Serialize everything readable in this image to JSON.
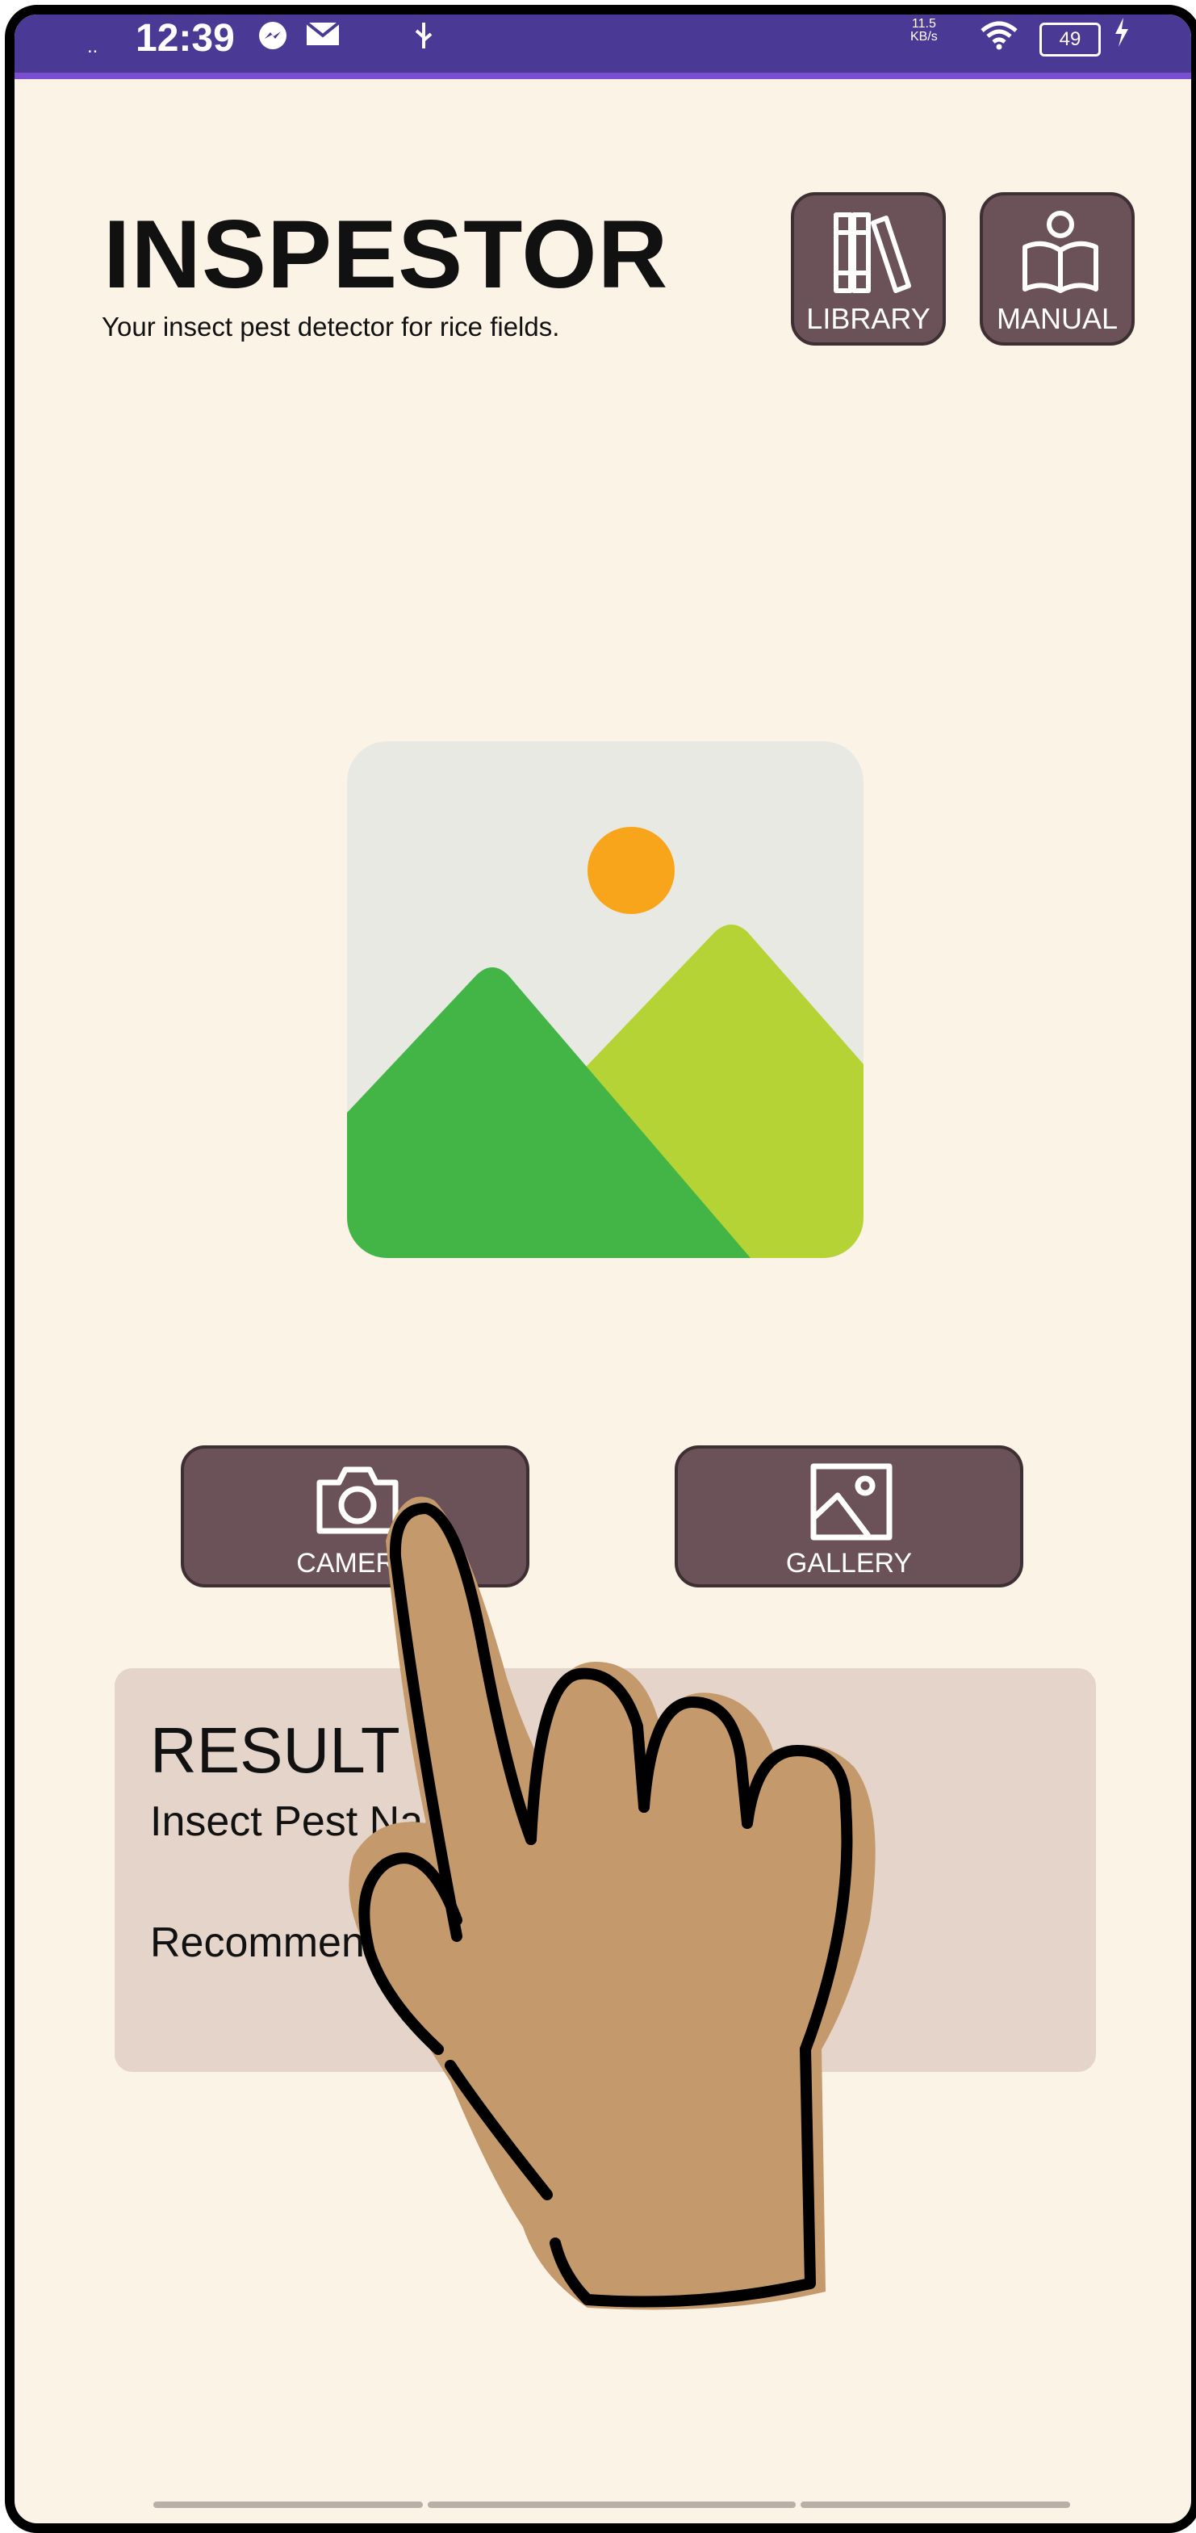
{
  "status_bar": {
    "signal": "..",
    "time": "12:39",
    "network_speed_value": "11.5",
    "network_speed_unit": "KB/s",
    "battery": "49",
    "icons": [
      "messenger-icon",
      "mail-icon",
      "usb-icon",
      "wifi-icon",
      "battery-icon",
      "charging-icon"
    ]
  },
  "header": {
    "title": "INSPESTOR",
    "subtitle": "Your insect pest detector for rice fields.",
    "library_label": "LIBRARY",
    "manual_label": "MANUAL"
  },
  "image_preview": {
    "icon": "image-placeholder-icon"
  },
  "actions": {
    "camera_label": "CAMERA",
    "gallery_label": "GALLERY"
  },
  "result": {
    "title": "RESULT",
    "pest_label": "Insect Pest Name:",
    "recommendation_label": "Recommendation:"
  },
  "colors": {
    "background": "#fcf3e7",
    "status_bar": "#4a3a96",
    "button": "#6b5258",
    "result_panel": "#e4d4ca",
    "hand": "#c4996b"
  }
}
